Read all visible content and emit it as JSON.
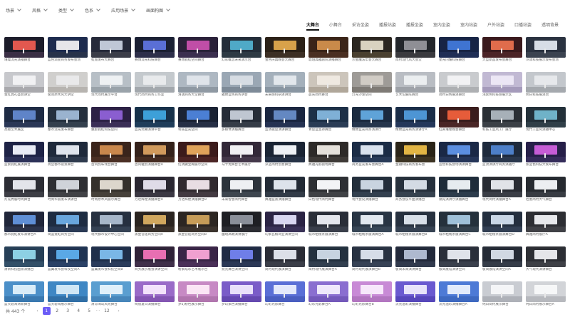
{
  "filters": [
    {
      "label": "场景"
    },
    {
      "label": "风格"
    },
    {
      "label": "类型"
    },
    {
      "label": "色系"
    },
    {
      "label": "应用场景"
    },
    {
      "label": "画面构图"
    }
  ],
  "tabs": [
    {
      "label": "大舞台",
      "active": true
    },
    {
      "label": "小舞台",
      "active": false
    },
    {
      "label": "采访坐姿",
      "active": false
    },
    {
      "label": "播报站姿",
      "active": false
    },
    {
      "label": "播报坐姿",
      "active": false
    },
    {
      "label": "室内坐姿",
      "active": false
    },
    {
      "label": "室内站姿",
      "active": false
    },
    {
      "label": "户外站姿",
      "active": false
    },
    {
      "label": "口播站姿",
      "active": false
    },
    {
      "label": "透明背景",
      "active": false
    }
  ],
  "items": [
    {
      "caption": "璀璨流光演播舞台",
      "bg": "#1c1c2a",
      "screen": "#e2584f",
      "floor": "#3a2f45"
    },
    {
      "caption": "蓝色渐变商务发布会场",
      "bg": "#1d2b4e",
      "screen": "#e6e6ea",
      "floor": "#27324a"
    },
    {
      "caption": "虹霓发布大舞台",
      "bg": "#262a3a",
      "screen": "#bfc7d6",
      "floor": "#3b3d48"
    },
    {
      "caption": "赛博流光科技舞台",
      "bg": "#1b2034",
      "screen": "#5a6fd6",
      "floor": "#2d2f4a"
    },
    {
      "caption": "赛博霓虹空间舞台",
      "bg": "#2a2139",
      "screen": "#c04ea7",
      "floor": "#3b2f4f"
    },
    {
      "caption": "幻彩概念未来演示台",
      "bg": "#232d39",
      "screen": "#4fa9c7",
      "floor": "#2e3a44"
    },
    {
      "caption": "金色庆典晚会大舞台",
      "bg": "#2b2117",
      "screen": "#d8a24a",
      "floor": "#3c2f24"
    },
    {
      "caption": "琥珀典雅剧院演播舞台",
      "bg": "#3a2418",
      "screen": "#c98a4a",
      "floor": "#4a2f22"
    },
    {
      "caption": "沙金魔法年会大舞台",
      "bg": "#2b2620",
      "screen": "#d9d2c0",
      "floor": "#4a4030"
    },
    {
      "caption": "简约现代风大会堂",
      "bg": "#23262b",
      "screen": "#8f8f95",
      "floor": "#3a3a3e"
    },
    {
      "caption": "星光闪耀科技舞台",
      "bg": "#172445",
      "screen": "#3f74d2",
      "floor": "#1f2e55"
    },
    {
      "caption": "大型新品发布会舞台",
      "bg": "#3a1a1d",
      "screen": "#e06c4c",
      "floor": "#4c2427"
    },
    {
      "caption": "冷调科技展示发布会场",
      "bg": "#2a3240",
      "screen": "#d7dde6",
      "floor": "#3b4350"
    },
    {
      "caption": "金红典礼盛会讲堂",
      "bg": "#c7c8cc",
      "screen": "#f1f1f3",
      "floor": "#a9a9ad"
    },
    {
      "caption": "极简原木风大讲堂",
      "bg": "#d0cfcd",
      "screen": "#e9e9ea",
      "floor": "#b7b4b0"
    },
    {
      "caption": "现代简约展示平台",
      "bg": "#b7bfc6",
      "screen": "#eef1f3",
      "floor": "#9aa3aa"
    },
    {
      "caption": "现代简约商务工作室",
      "bg": "#c4c9cd",
      "screen": "#e8eaec",
      "floor": "#a3a8ad"
    },
    {
      "caption": "清透商务大堂舞台",
      "bg": "#aeb8c2",
      "screen": "#dfe4ea",
      "floor": "#8f99a3"
    },
    {
      "caption": "雅致蓝色商务讲台",
      "bg": "#9aa7b4",
      "screen": "#d6dce3",
      "floor": "#7e8b98"
    },
    {
      "caption": "未来感科研演讲台",
      "bg": "#a4b0bb",
      "screen": "#e2e7ec",
      "floor": "#8996a2"
    },
    {
      "caption": "晨光简约舞台",
      "bg": "#ccc5bb",
      "screen": "#efe9e1",
      "floor": "#b0a79a"
    },
    {
      "caption": "灯光沙发空间",
      "bg": "#9e9b97",
      "screen": "#d1ccc5",
      "floor": "#7f7b76"
    },
    {
      "caption": "艺术馆展陈舞台",
      "bg": "#b9bdc3",
      "screen": "#ebeef0",
      "floor": "#9ea2a8"
    },
    {
      "caption": "简约白色展演舞台",
      "bg": "#c9cbce",
      "screen": "#f2f2f4",
      "floor": "#aeb0b3"
    },
    {
      "caption": "浅紫色科技感展示区",
      "bg": "#c1b9d3",
      "screen": "#ece7f5",
      "floor": "#a59bbb"
    },
    {
      "caption": "明日科技展演台",
      "bg": "#c3c7cc",
      "screen": "#e6e8eb",
      "floor": "#a5a9ae"
    },
    {
      "caption": "高级艺术展区",
      "bg": "#1e2b44",
      "screen": "#5f84c8",
      "floor": "#2a3756"
    },
    {
      "caption": "都市流光发布舞台",
      "bg": "#25303e",
      "screen": "#9ab3cf",
      "floor": "#34404e"
    },
    {
      "caption": "魅影霓虹科技空间",
      "bg": "#2c2145",
      "screen": "#8a5ed0",
      "floor": "#3b2f57"
    },
    {
      "caption": "蓝光荧幕演讲平台",
      "bg": "#17314a",
      "screen": "#3da0d8",
      "floor": "#1f3d5a"
    },
    {
      "caption": "科技蓝光空间",
      "bg": "#1a2233",
      "screen": "#4b7fd4",
      "floor": "#262f45"
    },
    {
      "caption": "多媒体演播舞台",
      "bg": "#252c37",
      "screen": "#bfc6d1",
      "floor": "#353c47"
    },
    {
      "caption": "蓝调夜空演讲舞台",
      "bg": "#1a2640",
      "screen": "#6488c2",
      "floor": "#253252"
    },
    {
      "caption": "青空蓝主持舞台",
      "bg": "#1d3047",
      "screen": "#7fb0d6",
      "floor": "#2a3c55"
    },
    {
      "caption": "精致蓝光商务演讲厅",
      "bg": "#1b2a3f",
      "screen": "#5fa3d8",
      "floor": "#25354c"
    },
    {
      "caption": "精致蓝光商务演讲厅A",
      "bg": "#1a2d48",
      "screen": "#4d95d4",
      "floor": "#24375a"
    },
    {
      "caption": "红黄璀璨晚会舞台",
      "bg": "#3a1d1d",
      "screen": "#e65c3a",
      "floor": "#4a2626"
    },
    {
      "caption": "科技工业风工厂展厅",
      "bg": "#2a2f35",
      "screen": "#a7b0b8",
      "floor": "#3b4046"
    },
    {
      "caption": "现代工业风演播中心",
      "bg": "#233039",
      "screen": "#6fb2c8",
      "floor": "#303f48"
    },
    {
      "caption": "蓝紫霓虹展演舞台",
      "bg": "#1e2346",
      "screen": "#e8ebf5",
      "floor": "#2c3158"
    },
    {
      "caption": "高空都市夜景舞台",
      "bg": "#1f2a3b",
      "screen": "#dfe4ec",
      "floor": "#2e3a4d"
    },
    {
      "caption": "古风韵味戏台舞台",
      "bg": "#3a241b",
      "screen": "#c9874c",
      "floor": "#4a2f24"
    },
    {
      "caption": "古风雅韵演播舞台A",
      "bg": "#34211a",
      "screen": "#d19a5c",
      "floor": "#452c22"
    },
    {
      "caption": "红调藏宝阁展示空间",
      "bg": "#3b1b1b",
      "screen": "#e0a35a",
      "floor": "#4c2525"
    },
    {
      "caption": "马卡龙舞台艺术展厅",
      "bg": "#322838",
      "screen": "#f0f0f3",
      "floor": "#44384a"
    },
    {
      "caption": "深蓝简约创意舞台",
      "bg": "#1a2434",
      "screen": "#eef1f5",
      "floor": "#263246"
    },
    {
      "caption": "典雅光影剧场舞台",
      "bg": "#2d2a28",
      "screen": "#e4e0da",
      "floor": "#3e3a37"
    },
    {
      "caption": "商务蓝光发布会舞台A",
      "bg": "#1b2c46",
      "screen": "#d9e2ee",
      "floor": "#283a57"
    },
    {
      "caption": "金融科技商务发布会",
      "bg": "#2a2418",
      "screen": "#e2b544",
      "floor": "#3c3424"
    },
    {
      "caption": "蓝色科技会场演讲舞台",
      "bg": "#1a2846",
      "screen": "#5b8ee0",
      "floor": "#253558"
    },
    {
      "caption": "蓝顶演讲厅商务演播厅",
      "bg": "#1e2a3c",
      "screen": "#4d7fc8",
      "floor": "#2a374c"
    },
    {
      "caption": "紫蓝色科技大发布舞台",
      "bg": "#261f48",
      "screen": "#c65cd6",
      "floor": "#352d5a"
    },
    {
      "caption": "灯光秀展时尚舞台",
      "bg": "#2c2d34",
      "screen": "#e3e4ea",
      "floor": "#3d3e45"
    },
    {
      "caption": "时尚华丽发布演讲台",
      "bg": "#2e2f33",
      "screen": "#cfd3d9",
      "floor": "#414246"
    },
    {
      "caption": "时尚原木风展示舞台",
      "bg": "#34302b",
      "screen": "#dcd6cc",
      "floor": "#46413a"
    },
    {
      "caption": "万达辉煌演播舞台A",
      "bg": "#2a2731",
      "screen": "#dfdbe8",
      "floor": "#3b3843"
    },
    {
      "caption": "万达辉煌演播舞台B",
      "bg": "#312a2f",
      "screen": "#e8dde3",
      "floor": "#433a41"
    },
    {
      "caption": "未来智慧简约舞台",
      "bg": "#2c333b",
      "screen": "#eef0f3",
      "floor": "#3e464f"
    },
    {
      "caption": "典雅蓝黑演播舞台",
      "bg": "#222a35",
      "screen": "#dde3eb",
      "floor": "#323b47"
    },
    {
      "caption": "白色现代简约舞台",
      "bg": "#2d2f33",
      "screen": "#f3f4f6",
      "floor": "#404246"
    },
    {
      "caption": "现代会议演播舞台",
      "bg": "#232e3b",
      "screen": "#c9d4e0",
      "floor": "#33404f"
    },
    {
      "caption": "商务会议平面演播台",
      "bg": "#26303c",
      "screen": "#d4dbe4",
      "floor": "#36424f"
    },
    {
      "caption": "湖光演讲厅演播舞台",
      "bg": "#1f2c3a",
      "screen": "#e6ebf0",
      "floor": "#2d3c4c"
    },
    {
      "caption": "现代简约演播舞台A",
      "bg": "#292c33",
      "screen": "#e1e3e8",
      "floor": "#3b3e46"
    },
    {
      "caption": "若墨简约大气舞台",
      "bg": "#262a30",
      "screen": "#eceef1",
      "floor": "#383c43"
    },
    {
      "caption": "都市霓虹发布演讲台A",
      "bg": "#20263a",
      "screen": "#5f8fd6",
      "floor": "#2d354c"
    },
    {
      "caption": "简蓝霓虹商务空间",
      "bg": "#1e2c42",
      "screen": "#69a6dd",
      "floor": "#2a3a55"
    },
    {
      "caption": "现代都市设计中心空间",
      "bg": "#263040",
      "screen": "#a6b6c9",
      "floor": "#354254"
    },
    {
      "caption": "黑金宫廷商务空间A",
      "bg": "#2a2420",
      "screen": "#d0a75e",
      "floor": "#3a322c"
    },
    {
      "caption": "黑金宫廷商务空间B",
      "bg": "#2c2622",
      "screen": "#c69c58",
      "floor": "#3c342e"
    },
    {
      "caption": "幽暗高端演讲展厅",
      "bg": "#1e1f24",
      "screen": "#8a8f99",
      "floor": "#2c2d33"
    },
    {
      "caption": "幻紫瓦楞商业演讲空间",
      "bg": "#2b2444",
      "screen": "#d8d6f0",
      "floor": "#3a3257"
    },
    {
      "caption": "城市粗线条展演舞台",
      "bg": "#2a2e38",
      "screen": "#e4e6ec",
      "floor": "#3a3f4b"
    },
    {
      "caption": "城市粗线条展演舞台A",
      "bg": "#283544",
      "screen": "#e1e8ef",
      "floor": "#374656"
    },
    {
      "caption": "城市粗线条展演舞台B",
      "bg": "#27313f",
      "screen": "#d8dfe8",
      "floor": "#364252"
    },
    {
      "caption": "城市粗线条展演舞台C",
      "bg": "#25313c",
      "screen": "#9fc0d8",
      "floor": "#35424e"
    },
    {
      "caption": "城市粗线条展演舞台D",
      "bg": "#242f3f",
      "screen": "#c9d6e5",
      "floor": "#334054"
    },
    {
      "caption": "典雅简约展厅A",
      "bg": "#2d2e33",
      "screen": "#e7e8eb",
      "floor": "#404146"
    },
    {
      "caption": "清新科技图景演播台",
      "bg": "#263f57",
      "screen": "#8dd0e4",
      "floor": "#335068"
    },
    {
      "caption": "蓝翼发布会科技空间A",
      "bg": "#1f3352",
      "screen": "#5aa8e6",
      "floor": "#2a4166"
    },
    {
      "caption": "蓝翼发布会科技空间B",
      "bg": "#1f2f4a",
      "screen": "#7ab7e6",
      "floor": "#2b3c5b"
    },
    {
      "caption": "商务展示展会演讲空间",
      "bg": "#2f2238",
      "screen": "#e86fb2",
      "floor": "#40304a"
    },
    {
      "caption": "粉紫炫彩艺术展示台",
      "bg": "#3a2547",
      "screen": "#f0a0d0",
      "floor": "#4a3058"
    },
    {
      "caption": "霓光舞台演讲空间",
      "bg": "#1f2a44",
      "screen": "#6f7ee8",
      "floor": "#2b3856"
    },
    {
      "caption": "简约现代展演舞台",
      "bg": "#2a2c35",
      "screen": "#dde0e8",
      "floor": "#3b3e48"
    },
    {
      "caption": "简约现代展演舞台A",
      "bg": "#23303e",
      "screen": "#c7d3e0",
      "floor": "#323f4f"
    },
    {
      "caption": "简约现代展演舞台B",
      "bg": "#283242",
      "screen": "#d6dde8",
      "floor": "#374255"
    },
    {
      "caption": "极简未来演讲舞台",
      "bg": "#22293a",
      "screen": "#aeb9cf",
      "floor": "#313a4d"
    },
    {
      "caption": "极简展馆演讲空间",
      "bg": "#2a2f3a",
      "screen": "#dfe3ea",
      "floor": "#3a404c"
    },
    {
      "caption": "极简展馆演讲空间A",
      "bg": "#252b36",
      "screen": "#d1d8e3",
      "floor": "#353c48"
    },
    {
      "caption": "大气现代演讲舞台",
      "bg": "#2c2e34",
      "screen": "#e5e6ea",
      "floor": "#3e4046"
    },
    {
      "caption": "蓝天碧海清新舞台",
      "bg": "#4b8fc8",
      "screen": "#d9ecf8",
      "floor": "#3a79b0"
    },
    {
      "caption": "蓝天碧海展示舞台",
      "bg": "#3f87c4",
      "screen": "#cfe6f5",
      "floor": "#316fa6"
    },
    {
      "caption": "清凉海岛风光舞台",
      "bg": "#5a9ed0",
      "screen": "#e0f0fa",
      "floor": "#4786ba"
    },
    {
      "caption": "绚丽夏日演播舞台",
      "bg": "#9a6bc8",
      "screen": "#f3e3fb",
      "floor": "#8456b2"
    },
    {
      "caption": "梦幻粉色展示舞台",
      "bg": "#c78ac4",
      "screen": "#fbe6f5",
      "floor": "#b176ae"
    },
    {
      "caption": "梦幻紫色演播舞台",
      "bg": "#7a5cc8",
      "screen": "#e9e1fa",
      "floor": "#6549b0"
    },
    {
      "caption": "幻彩光影舞台",
      "bg": "#5a6fd6",
      "screen": "#e3e8fb",
      "floor": "#4a5ec0"
    },
    {
      "caption": "幻彩光影舞台A",
      "bg": "#8a6ed0",
      "screen": "#efe8fb",
      "floor": "#7459ba"
    },
    {
      "caption": "幻彩光影舞台B",
      "bg": "#c88ad6",
      "screen": "#f7e8fb",
      "floor": "#b276c0"
    },
    {
      "caption": "流光溢彩演播舞台",
      "bg": "#6a5ad0",
      "screen": "#e8e4fa",
      "floor": "#5647ba"
    },
    {
      "caption": "流光溢彩演播舞台A",
      "bg": "#4d7ad6",
      "screen": "#e2ebfb",
      "floor": "#3e69c0"
    },
    {
      "caption": "纯白简约展示舞台",
      "bg": "#c9ccd2",
      "screen": "#f4f5f7",
      "floor": "#aeb1b8"
    },
    {
      "caption": "纯白简约展示舞台A",
      "bg": "#d2d4d8",
      "screen": "#f6f7f8",
      "floor": "#b7b9be"
    }
  ],
  "pagination": {
    "total": "共 443 个",
    "prev": "‹",
    "next": "›",
    "pages": [
      {
        "label": "1",
        "active": true
      },
      {
        "label": "2",
        "active": false
      },
      {
        "label": "3",
        "active": false
      },
      {
        "label": "4",
        "active": false
      },
      {
        "label": "5",
        "active": false
      }
    ],
    "ellipsis": "···",
    "last": "12",
    "accent": "#6b5cf6"
  }
}
